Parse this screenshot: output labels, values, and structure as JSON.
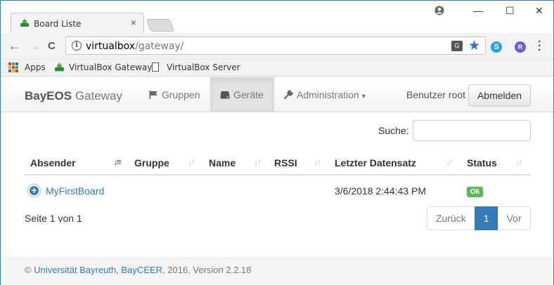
{
  "browser": {
    "tab_title": "Board Liste",
    "tab_close": "×",
    "window_minimize": "—",
    "window_maximize": "☐",
    "window_close": "✕",
    "url_host": "virtualbox",
    "url_path": "/gateway/",
    "bookmarks": [
      "Apps",
      "VirtualBox Gateway",
      "VirtualBox Server"
    ],
    "icons": {
      "back": "←",
      "forward": "→",
      "reload": "C",
      "star": "★",
      "skype": "S",
      "extension_r": "R",
      "translate": "G"
    }
  },
  "nav": {
    "brand_bold": "BayEOS",
    "brand_rest": " Gateway",
    "items": [
      {
        "label": "Gruppen",
        "icon": "flag-icon"
      },
      {
        "label": "Geräte",
        "icon": "hdd-icon",
        "active": true
      },
      {
        "label": "Administration",
        "icon": "wrench-icon",
        "dropdown": true
      }
    ],
    "user_text": "Benutzer root",
    "logout_label": "Abmelden"
  },
  "search": {
    "label": "Suche:",
    "value": ""
  },
  "table": {
    "columns": [
      "Absender",
      "Gruppe",
      "Name",
      "RSSI",
      "Letzter Datensatz",
      "Status"
    ],
    "rows": [
      {
        "absender": "MyFirstBoard",
        "gruppe": "",
        "name": "",
        "rssi": "",
        "letzter_datensatz": "3/6/2018 2:44:43 PM",
        "status": "Ok"
      }
    ]
  },
  "pagination": {
    "info": "Seite 1 von 1",
    "prev": "Zurück",
    "current": "1",
    "next": "Vor"
  },
  "footer": {
    "copyright": "© ",
    "link1": "Universität Bayreuth",
    "sep": ", ",
    "link2": "BayCEER",
    "rest": ", 2016, Version 2.2.18"
  },
  "colors": {
    "link": "#337ab7",
    "status_ok": "#5cb85c",
    "pagination_active": "#337ab7"
  }
}
